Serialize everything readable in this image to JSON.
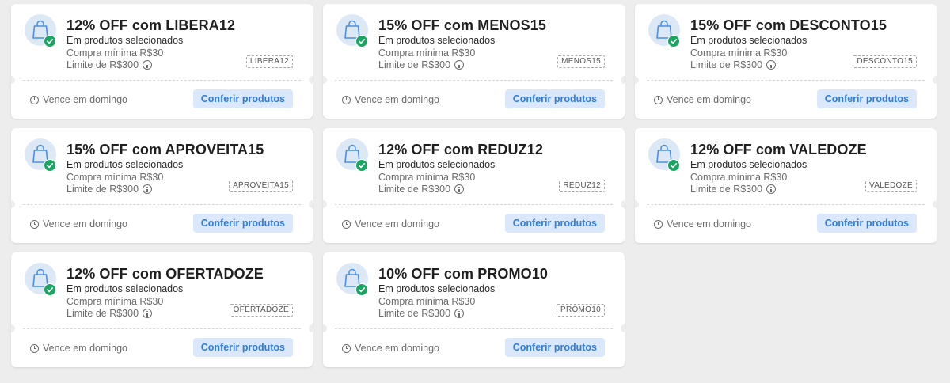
{
  "colors": {
    "background": "#ededed",
    "card": "#ffffff",
    "icon_bg": "#dde8f7",
    "icon_stroke": "#4a8fe0",
    "check_badge": "#1aa563",
    "button_bg": "#dbe8fb",
    "button_text": "#2f7de1"
  },
  "coupons": [
    {
      "title": "12% OFF com LIBERA12",
      "scope": "Em produtos selecionados",
      "min_purchase": "Compra mínima R$30",
      "limit": "Limite de R$300",
      "code": "LIBERA12",
      "expiry": "Vence em domingo",
      "button": "Conferir produtos",
      "icon": "shopping-bag-icon"
    },
    {
      "title": "15% OFF com MENOS15",
      "scope": "Em produtos selecionados",
      "min_purchase": "Compra mínima R$30",
      "limit": "Limite de R$300",
      "code": "MENOS15",
      "expiry": "Vence em domingo",
      "button": "Conferir produtos",
      "icon": "shopping-bag-icon"
    },
    {
      "title": "15% OFF com DESCONTO15",
      "scope": "Em produtos selecionados",
      "min_purchase": "Compra mínima R$30",
      "limit": "Limite de R$300",
      "code": "DESCONTO15",
      "expiry": "Vence em domingo",
      "button": "Conferir produtos",
      "icon": "shopping-bag-icon"
    },
    {
      "title": "15% OFF com APROVEITA15",
      "scope": "Em produtos selecionados",
      "min_purchase": "Compra mínima R$30",
      "limit": "Limite de R$300",
      "code": "APROVEITA15",
      "expiry": "Vence em domingo",
      "button": "Conferir produtos",
      "icon": "shopping-bag-icon"
    },
    {
      "title": "12% OFF com REDUZ12",
      "scope": "Em produtos selecionados",
      "min_purchase": "Compra mínima R$30",
      "limit": "Limite de R$300",
      "code": "REDUZ12",
      "expiry": "Vence em domingo",
      "button": "Conferir produtos",
      "icon": "shopping-bag-icon"
    },
    {
      "title": "12% OFF com VALEDOZE",
      "scope": "Em produtos selecionados",
      "min_purchase": "Compra mínima R$30",
      "limit": "Limite de R$300",
      "code": "VALEDOZE",
      "expiry": "Vence em domingo",
      "button": "Conferir produtos",
      "icon": "shopping-bag-icon"
    },
    {
      "title": "12% OFF com OFERTADOZE",
      "scope": "Em produtos selecionados",
      "min_purchase": "Compra mínima R$30",
      "limit": "Limite de R$300",
      "code": "OFERTADOZE",
      "expiry": "Vence em domingo",
      "button": "Conferir produtos",
      "icon": "shopping-bag-icon"
    },
    {
      "title": "10% OFF com PROMO10",
      "scope": "Em produtos selecionados",
      "min_purchase": "Compra mínima R$30",
      "limit": "Limite de R$300",
      "code": "PROMO10",
      "expiry": "Vence em domingo",
      "button": "Conferir produtos",
      "icon": "shopping-bag-icon"
    }
  ]
}
